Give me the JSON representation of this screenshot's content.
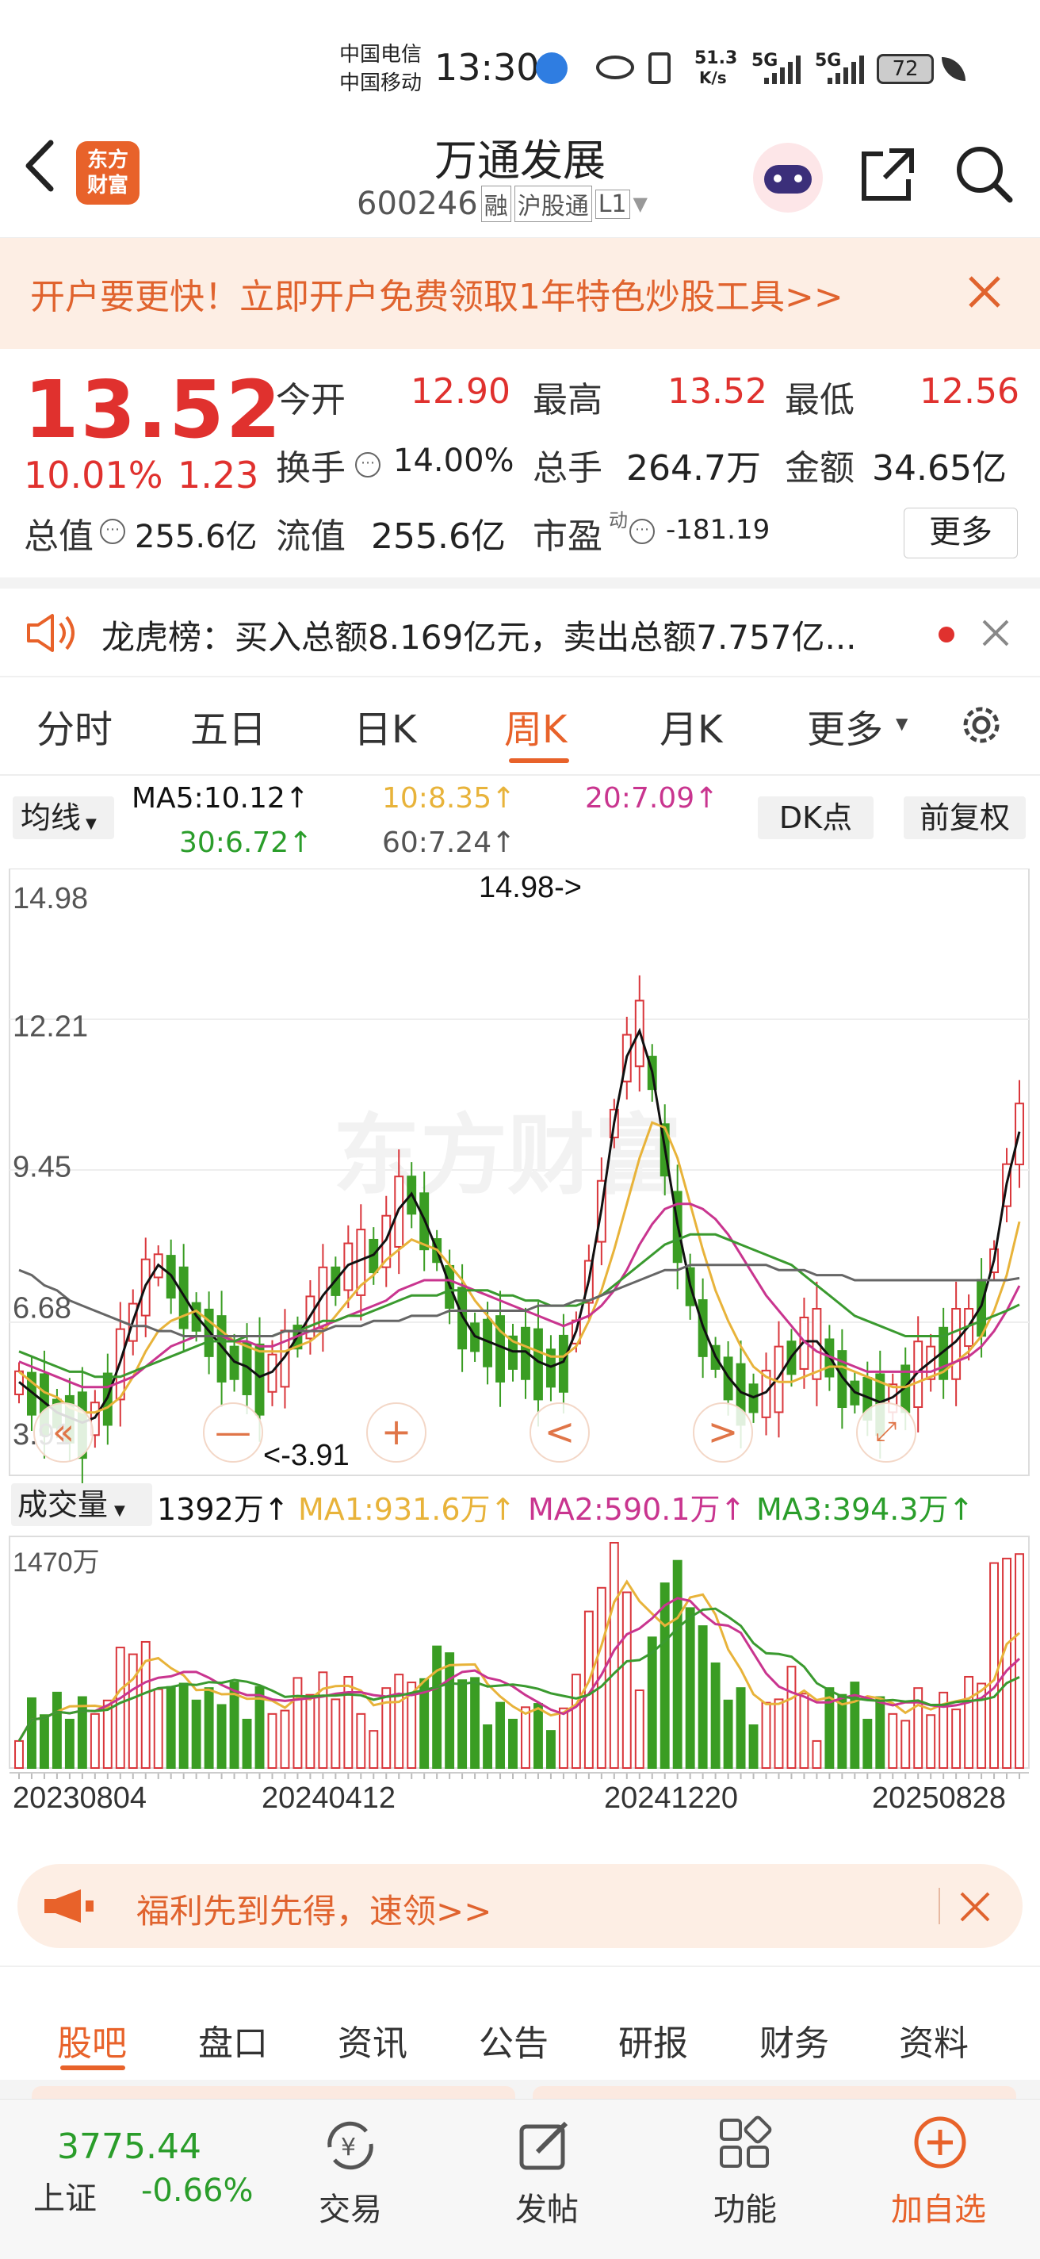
{
  "status_bar": {
    "carrier1": "中国电信",
    "carrier2": "中国移动",
    "time": "13:30",
    "net_speed": "51.3",
    "net_unit": "K/s",
    "signal1": "5G",
    "signal2": "5G",
    "battery": "72"
  },
  "header": {
    "back_label": "<",
    "logo_line1": "东方",
    "logo_line2": "财富",
    "title": "万通发展",
    "code": "600246",
    "badge_rong": "融",
    "badge_hgt": "沪股通",
    "badge_l1": "L1"
  },
  "promo_banner": {
    "text": "开户要更快！立即开户免费领取1年特色炒股工具>>"
  },
  "quote": {
    "price": "13.52",
    "change_pct": "10.01%",
    "change_amt": "1.23",
    "open_label": "今开",
    "open_value": "12.90",
    "high_label": "最高",
    "high_value": "13.52",
    "low_label": "最低",
    "low_value": "12.56",
    "turnover_label": "换手",
    "turnover_value": "14.00%",
    "volume_label": "总手",
    "volume_value": "264.7万",
    "amount_label": "金额",
    "amount_value": "34.65亿",
    "total_mv_label": "总值",
    "total_mv_value": "255.6亿",
    "float_mv_label": "流值",
    "float_mv_value": "255.6亿",
    "pe_label": "市盈",
    "pe_sup": "动",
    "pe_value": "-181.19",
    "more_button": "更多"
  },
  "notice": {
    "text": "龙虎榜：买入总额8.169亿元，卖出总额7.757亿..."
  },
  "period_tabs": [
    {
      "label": "分时",
      "active": false
    },
    {
      "label": "五日",
      "active": false
    },
    {
      "label": "日K",
      "active": false
    },
    {
      "label": "周K",
      "active": true
    },
    {
      "label": "月K",
      "active": false
    },
    {
      "label": "更多",
      "active": false
    }
  ],
  "ma_bar": {
    "selector": "均线",
    "ma5": "MA5:10.12↑",
    "ma10": "10:8.35↑",
    "ma20": "20:7.09↑",
    "ma30": "30:6.72↑",
    "ma60": "60:7.24↑",
    "dk_button": "DK点",
    "adjust_button": "前复权"
  },
  "colors": {
    "up": "#d9363b",
    "down": "#3a9d23",
    "ma5": "#111111",
    "ma10": "#e8b33a",
    "ma20": "#c9358f",
    "ma30": "#3a9a2f",
    "ma60": "#666666",
    "accent": "#e8622a"
  },
  "chart_data": [
    {
      "type": "candlestick",
      "y_ticks": [
        "14.98",
        "12.21",
        "9.45",
        "6.68",
        "3.91"
      ],
      "ylim": [
        3.91,
        14.98
      ],
      "max_label": "14.98->",
      "min_label": "<-3.91",
      "watermark": "东方财富",
      "series": [
        {
          "name": "MA5",
          "values": [
            5.2,
            5.0,
            4.8,
            4.6,
            4.5,
            4.4,
            4.5,
            4.9,
            5.6,
            6.4,
            7.1,
            7.5,
            7.3,
            6.9,
            6.5,
            6.2,
            5.9,
            5.6,
            5.5,
            5.3,
            5.4,
            5.7,
            6.1,
            6.5,
            6.9,
            7.2,
            7.5,
            7.6,
            7.7,
            8.0,
            8.6,
            8.9,
            8.4,
            7.8,
            7.1,
            6.5,
            6.1,
            6.0,
            5.9,
            5.8,
            5.8,
            5.6,
            5.5,
            5.6,
            6.2,
            7.2,
            8.6,
            10.3,
            11.6,
            12.1,
            11.3,
            9.8,
            8.3,
            7.1,
            6.3,
            5.7,
            5.3,
            5.0,
            4.9,
            5.0,
            5.3,
            5.7,
            6.0,
            6.0,
            5.7,
            5.3,
            5.0,
            4.9,
            4.8,
            4.9,
            5.1,
            5.4,
            5.6,
            5.8,
            6.0,
            6.3,
            6.7,
            7.6,
            9.1,
            10.12
          ]
        },
        {
          "name": "MA10",
          "values": [
            5.4,
            5.2,
            5.0,
            4.9,
            4.7,
            4.6,
            4.6,
            4.7,
            4.9,
            5.3,
            5.8,
            6.2,
            6.4,
            6.5,
            6.6,
            6.4,
            6.2,
            6.0,
            5.9,
            5.8,
            5.8,
            5.8,
            5.9,
            6.0,
            6.2,
            6.5,
            6.8,
            7.1,
            7.3,
            7.6,
            7.8,
            8.0,
            7.9,
            7.8,
            7.5,
            7.2,
            6.8,
            6.5,
            6.2,
            6.0,
            5.9,
            5.8,
            5.7,
            5.7,
            5.9,
            6.4,
            7.0,
            7.8,
            8.7,
            9.6,
            10.3,
            10.2,
            9.6,
            8.7,
            7.8,
            7.0,
            6.4,
            5.9,
            5.5,
            5.3,
            5.2,
            5.2,
            5.3,
            5.4,
            5.5,
            5.5,
            5.4,
            5.3,
            5.2,
            5.1,
            5.1,
            5.2,
            5.3,
            5.4,
            5.6,
            5.8,
            6.1,
            6.6,
            7.3,
            8.35
          ]
        },
        {
          "name": "MA20",
          "values": [
            5.6,
            5.5,
            5.4,
            5.3,
            5.2,
            5.1,
            5.1,
            5.1,
            5.2,
            5.3,
            5.5,
            5.7,
            5.9,
            6.0,
            6.1,
            6.1,
            6.1,
            6.0,
            6.0,
            5.9,
            5.9,
            6.0,
            6.1,
            6.2,
            6.3,
            6.4,
            6.5,
            6.6,
            6.7,
            6.8,
            7.0,
            7.1,
            7.2,
            7.2,
            7.2,
            7.1,
            7.0,
            6.9,
            6.8,
            6.7,
            6.6,
            6.5,
            6.4,
            6.3,
            6.4,
            6.5,
            6.7,
            7.0,
            7.4,
            7.9,
            8.3,
            8.6,
            8.7,
            8.7,
            8.6,
            8.4,
            8.1,
            7.7,
            7.3,
            6.9,
            6.6,
            6.3,
            6.0,
            5.8,
            5.7,
            5.6,
            5.5,
            5.4,
            5.4,
            5.4,
            5.4,
            5.4,
            5.4,
            5.5,
            5.6,
            5.7,
            5.9,
            6.2,
            6.6,
            7.09
          ]
        },
        {
          "name": "MA30",
          "values": [
            5.8,
            5.7,
            5.6,
            5.5,
            5.4,
            5.4,
            5.3,
            5.3,
            5.3,
            5.4,
            5.5,
            5.6,
            5.7,
            5.8,
            5.9,
            6.0,
            6.0,
            6.0,
            6.1,
            6.1,
            6.1,
            6.2,
            6.2,
            6.3,
            6.4,
            6.4,
            6.5,
            6.5,
            6.6,
            6.7,
            6.8,
            6.9,
            6.9,
            6.9,
            7.0,
            7.0,
            7.0,
            7.0,
            6.9,
            6.9,
            6.8,
            6.8,
            6.7,
            6.7,
            6.7,
            6.8,
            6.9,
            7.1,
            7.3,
            7.5,
            7.7,
            7.9,
            8.0,
            8.1,
            8.1,
            8.1,
            8.0,
            7.9,
            7.8,
            7.7,
            7.6,
            7.5,
            7.3,
            7.1,
            6.9,
            6.7,
            6.5,
            6.4,
            6.3,
            6.2,
            6.1,
            6.1,
            6.1,
            6.1,
            6.2,
            6.3,
            6.4,
            6.5,
            6.6,
            6.72
          ]
        },
        {
          "name": "MA60",
          "values": [
            7.4,
            7.3,
            7.1,
            7.0,
            6.8,
            6.7,
            6.6,
            6.5,
            6.4,
            6.3,
            6.3,
            6.2,
            6.2,
            6.1,
            6.1,
            6.1,
            6.1,
            6.1,
            6.1,
            6.1,
            6.1,
            6.2,
            6.2,
            6.2,
            6.2,
            6.3,
            6.3,
            6.3,
            6.4,
            6.4,
            6.4,
            6.5,
            6.5,
            6.5,
            6.6,
            6.6,
            6.6,
            6.6,
            6.6,
            6.6,
            6.6,
            6.7,
            6.7,
            6.7,
            6.8,
            6.8,
            6.9,
            7.0,
            7.1,
            7.2,
            7.3,
            7.4,
            7.4,
            7.5,
            7.5,
            7.5,
            7.5,
            7.5,
            7.5,
            7.5,
            7.4,
            7.4,
            7.4,
            7.3,
            7.3,
            7.3,
            7.2,
            7.2,
            7.2,
            7.2,
            7.2,
            7.2,
            7.2,
            7.2,
            7.2,
            7.2,
            7.2,
            7.2,
            7.2,
            7.24
          ]
        }
      ]
    },
    {
      "type": "bar",
      "title": "成交量",
      "latest": "1392万↑",
      "ma1": "MA1:931.6万↑",
      "ma2": "MA2:590.1万↑",
      "ma3": "MA3:394.3万↑",
      "y_max_label": "1470万",
      "x_ticks": [
        "20230804",
        "20240412",
        "20241220",
        "20250828"
      ]
    }
  ],
  "chart_controls": {
    "rewind": "«",
    "zoom_out": "—",
    "zoom_in": "+",
    "prev": "<",
    "next": ">"
  },
  "welfare_banner": {
    "text": "福利先到先得，速领>>"
  },
  "bottom_tabs": [
    {
      "label": "股吧",
      "active": true
    },
    {
      "label": "盘口",
      "active": false
    },
    {
      "label": "资讯",
      "active": false
    },
    {
      "label": "公告",
      "active": false
    },
    {
      "label": "研报",
      "active": false
    },
    {
      "label": "财务",
      "active": false
    },
    {
      "label": "资料",
      "active": false
    }
  ],
  "nav": {
    "index_value": "3775.44",
    "index_name": "上证",
    "index_change": "-0.66%",
    "trade": "交易",
    "post": "发帖",
    "function": "功能",
    "add_watch": "加自选"
  }
}
